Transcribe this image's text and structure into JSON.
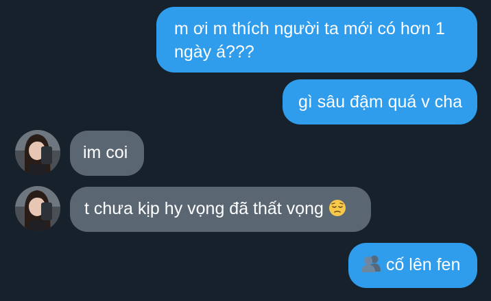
{
  "messages": [
    {
      "direction": "outgoing",
      "text": "m ơi m thích người ta mới có hơn 1 ngày á???"
    },
    {
      "direction": "outgoing",
      "text": "gì sâu đậm quá v cha"
    },
    {
      "direction": "incoming",
      "text": "im coi"
    },
    {
      "direction": "incoming",
      "text": "t chưa kịp hy vọng đã thất vọng",
      "emoji": "pensive-face"
    },
    {
      "direction": "outgoing",
      "text": "cố lên fen",
      "emoji": "busts-in-silhouette"
    }
  ],
  "colors": {
    "background": "#17212b",
    "outgoing_bubble": "#2f9cec",
    "incoming_bubble": "#5a6773",
    "text": "#ffffff"
  }
}
